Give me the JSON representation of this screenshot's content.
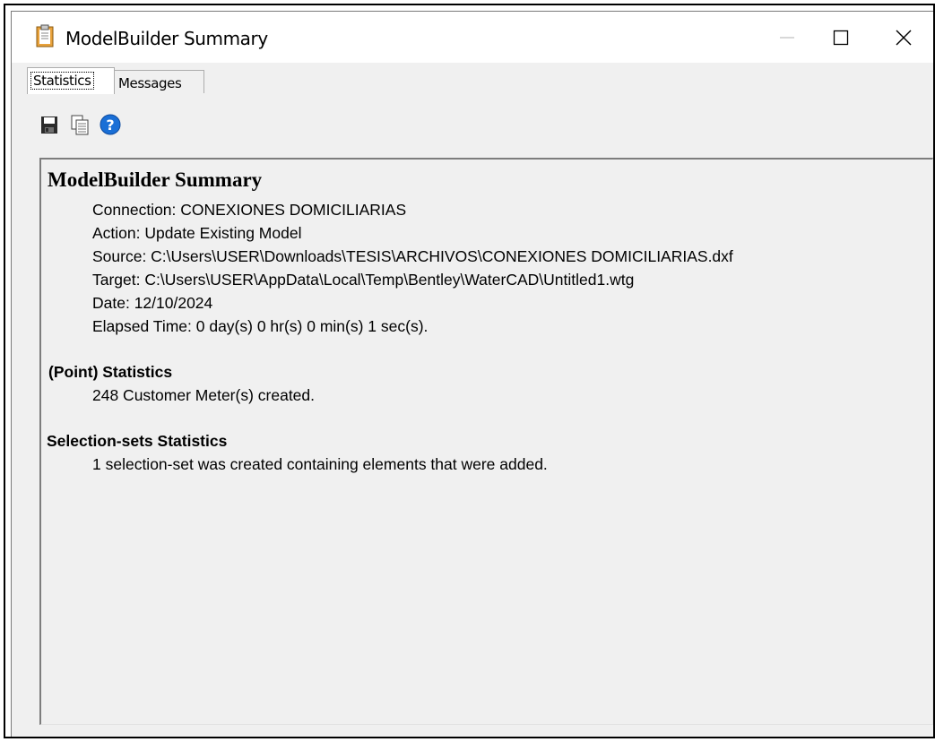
{
  "window": {
    "title": "ModelBuilder Summary",
    "minimize_symbol": "—",
    "maximize_symbol": "☐",
    "close_symbol": "✕"
  },
  "tabs": [
    {
      "label": "Statistics",
      "selected": true
    },
    {
      "label": "Messages",
      "selected": false
    }
  ],
  "toolbar": {
    "icons": [
      "save-icon",
      "copy-icon",
      "help-icon"
    ],
    "help_color": "#1a6fd6"
  },
  "report": {
    "title": "ModelBuilder Summary",
    "connection": "Connection: CONEXIONES DOMICILIARIAS",
    "action": "Action: Update Existing Model",
    "source": "Source: C:\\Users\\USER\\Downloads\\TESIS\\ARCHIVOS\\CONEXIONES DOMICILIARIAS.dxf",
    "target": "Target: C:\\Users\\USER\\AppData\\Local\\Temp\\Bentley\\WaterCAD\\Untitled1.wtg",
    "date": "Date: 12/10/2024",
    "elapsed": "Elapsed Time: 0 day(s) 0 hr(s) 0 min(s) 1 sec(s).",
    "point_heading": "(Point) Statistics",
    "point_line": "248 Customer Meter(s) created.",
    "selection_heading": "Selection-sets Statistics",
    "selection_line": "1 selection-set was created containing elements that were added."
  }
}
